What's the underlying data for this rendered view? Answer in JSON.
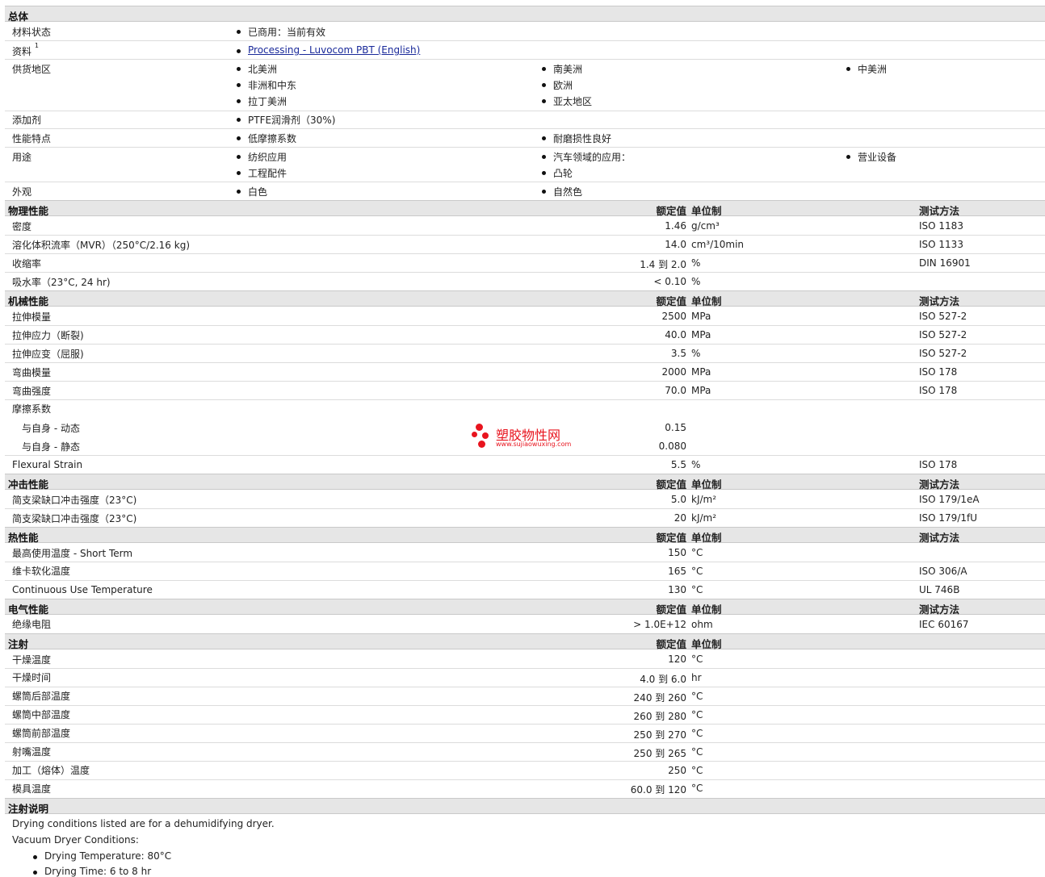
{
  "colors": {
    "header_bg": "#e6e6e6",
    "link": "#1a2a9a",
    "watermark": "#e8141e"
  },
  "general": {
    "title": "总体",
    "material_status": {
      "label": "材料状态",
      "value": "已商用：当前有效"
    },
    "docs": {
      "label": "资料",
      "sup": "1",
      "link": "Processing - Luvocom PBT (English)"
    },
    "regions": {
      "label": "供货地区",
      "items": [
        "北美洲",
        "南美洲",
        "中美洲",
        "非洲和中东",
        "欧洲",
        "拉丁美洲",
        "亚太地区"
      ]
    },
    "additive": {
      "label": "添加剂",
      "value": "PTFE润滑剂（30%)"
    },
    "features": {
      "label": "性能特点",
      "items": [
        "低摩擦系数",
        "耐磨损性良好"
      ]
    },
    "uses": {
      "label": "用途",
      "items": [
        "纺织应用",
        "汽车领域的应用：",
        "营业设备",
        "工程配件",
        "凸轮"
      ]
    },
    "appearance": {
      "label": "外观",
      "items": [
        "白色",
        "自然色"
      ]
    }
  },
  "col": {
    "nominal": "额定值",
    "unit": "单位制",
    "method": "测试方法"
  },
  "physical": {
    "title": "物理性能",
    "rows": [
      {
        "label": "密度",
        "value": "1.46",
        "unit": "g/cm³",
        "method": "ISO 1183"
      },
      {
        "label": "溶化体积流率（MVR）（250°C/2.16 kg)",
        "value": "14.0",
        "unit": "cm³/10min",
        "method": "ISO 1133"
      },
      {
        "label": "收缩率",
        "value": "1.4 到  2.0",
        "unit": "%",
        "method": "DIN 16901"
      },
      {
        "label": "吸水率（23°C, 24 hr)",
        "value": "< 0.10",
        "unit": "%",
        "method": ""
      }
    ]
  },
  "mechanical": {
    "title": "机械性能",
    "rows": [
      {
        "label": "拉伸模量",
        "value": "2500",
        "unit": "MPa",
        "method": "ISO 527-2"
      },
      {
        "label": "拉伸应力（断裂)",
        "value": "40.0",
        "unit": "MPa",
        "method": "ISO 527-2"
      },
      {
        "label": "拉伸应变（屈服)",
        "value": "3.5",
        "unit": "%",
        "method": "ISO 527-2"
      },
      {
        "label": "弯曲模量",
        "value": "2000",
        "unit": "MPa",
        "method": "ISO 178"
      },
      {
        "label": "弯曲强度",
        "value": "70.0",
        "unit": "MPa",
        "method": "ISO 178"
      }
    ],
    "friction": {
      "label": "摩擦系数",
      "dynamic": {
        "label": "与自身  - 动态",
        "value": "0.15"
      },
      "static": {
        "label": "与自身  - 静态",
        "value": "0.080"
      }
    },
    "flex_strain": {
      "label": "Flexural Strain",
      "value": "5.5",
      "unit": "%",
      "method": "ISO 178"
    }
  },
  "impact": {
    "title": "冲击性能",
    "rows": [
      {
        "label": "简支梁缺口冲击强度（23°C)",
        "value": "5.0",
        "unit": "kJ/m²",
        "method": "ISO 179/1eA"
      },
      {
        "label": "简支梁缺口冲击强度（23°C)",
        "value": "20",
        "unit": "kJ/m²",
        "method": "ISO 179/1fU"
      }
    ]
  },
  "thermal": {
    "title": "热性能",
    "rows": [
      {
        "label": "最高使用温度  - Short Term",
        "value": "150",
        "unit": "°C",
        "method": ""
      },
      {
        "label": "维卡软化温度",
        "value": "165",
        "unit": "°C",
        "method": "ISO 306/A"
      },
      {
        "label": "Continuous Use Temperature",
        "value": "130",
        "unit": "°C",
        "method": "UL 746B"
      }
    ]
  },
  "electrical": {
    "title": "电气性能",
    "rows": [
      {
        "label": "绝缘电阻",
        "value": "> 1.0E+12",
        "unit": "ohm",
        "method": "IEC 60167"
      }
    ]
  },
  "injection": {
    "title": "注射",
    "rows": [
      {
        "label": "干燥温度",
        "value": "120",
        "unit": "°C"
      },
      {
        "label": "干燥时间",
        "value": "4.0 到  6.0",
        "unit": "hr"
      },
      {
        "label": "螺筒后部温度",
        "value": "240 到  260",
        "unit": "°C"
      },
      {
        "label": "螺筒中部温度",
        "value": "260 到  280",
        "unit": "°C"
      },
      {
        "label": "螺筒前部温度",
        "value": "250 到  270",
        "unit": "°C"
      },
      {
        "label": "射嘴温度",
        "value": "250 到  265",
        "unit": "°C"
      },
      {
        "label": "加工（熔体）温度",
        "value": "250",
        "unit": "°C"
      },
      {
        "label": "模具温度",
        "value": "60.0 到  120",
        "unit": "°C"
      }
    ]
  },
  "notes": {
    "title": "注射说明",
    "line1": "Drying conditions listed are for a dehumidifying dryer.",
    "line2": "Vacuum Dryer Conditions:",
    "b1": "Drying Temperature: 80°C",
    "b2": "Drying Time: 6 to 8 hr"
  },
  "watermark": {
    "name": "塑胶物性网",
    "url": "www.sujiaowuxing.com"
  }
}
